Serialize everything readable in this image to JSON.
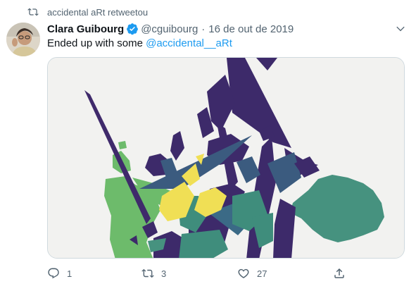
{
  "retweet": {
    "icon": "retweet-icon",
    "text": "accidental aRt retweetou"
  },
  "tweet": {
    "author_name": "Clara Guibourg",
    "verified_icon": "verified-badge-icon",
    "handle": "@cguibourg",
    "separator": "·",
    "date": "16 de out de 2019",
    "text_prefix": "Ended up with some ",
    "mention": "@accidental__aRt",
    "more_icon": "chevron-down-icon"
  },
  "media": {
    "description_icon": "abstract-art-image"
  },
  "actions": {
    "reply_count": "1",
    "retweet_count": "3",
    "like_count": "27"
  },
  "colors": {
    "accent": "#1d9bf0",
    "secondary_text": "#536471",
    "purple": "#3b2a66",
    "green": "#6aba6a",
    "teal": "#4a9a8a",
    "yellow": "#f3e05a"
  }
}
